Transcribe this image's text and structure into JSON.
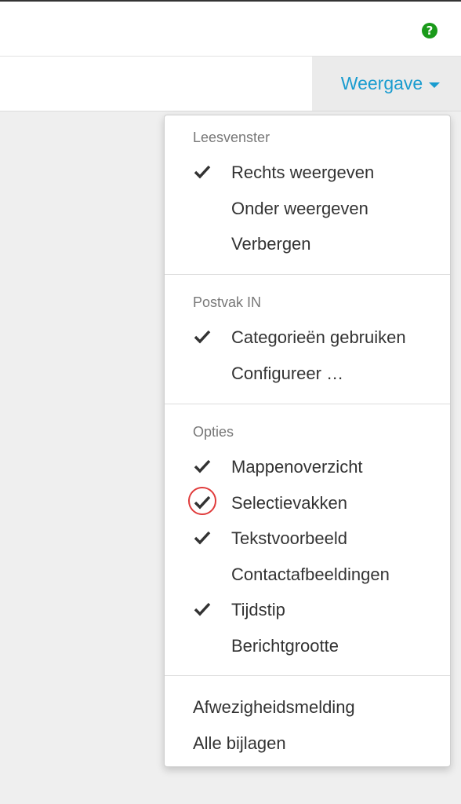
{
  "top_bar": {
    "help_icon": "question-circle-icon",
    "help_glyph": "?",
    "help_color": "#1a9a1a"
  },
  "toolbar": {
    "view_button_label": "Weergave",
    "accent_color": "#1a9ccf"
  },
  "menu": {
    "sections": [
      {
        "header": "Leesvenster",
        "items": [
          {
            "label": "Rechts weergeven",
            "checked": true
          },
          {
            "label": "Onder weergeven",
            "checked": false
          },
          {
            "label": "Verbergen",
            "checked": false
          }
        ]
      },
      {
        "header": "Postvak IN",
        "items": [
          {
            "label": "Categorieën gebruiken",
            "checked": true
          },
          {
            "label": "Configureer …",
            "checked": false
          }
        ]
      },
      {
        "header": "Opties",
        "items": [
          {
            "label": "Mappenoverzicht",
            "checked": true
          },
          {
            "label": "Selectievakken",
            "checked": true,
            "highlighted": true
          },
          {
            "label": "Tekstvoorbeeld",
            "checked": true
          },
          {
            "label": "Contactafbeeldingen",
            "checked": false
          },
          {
            "label": "Tijdstip",
            "checked": true
          },
          {
            "label": "Berichtgrootte",
            "checked": false
          }
        ]
      }
    ],
    "footer_items": [
      {
        "label": "Afwezigheidsmelding"
      },
      {
        "label": "Alle bijlagen"
      }
    ],
    "highlight_color": "#e03b3b"
  }
}
